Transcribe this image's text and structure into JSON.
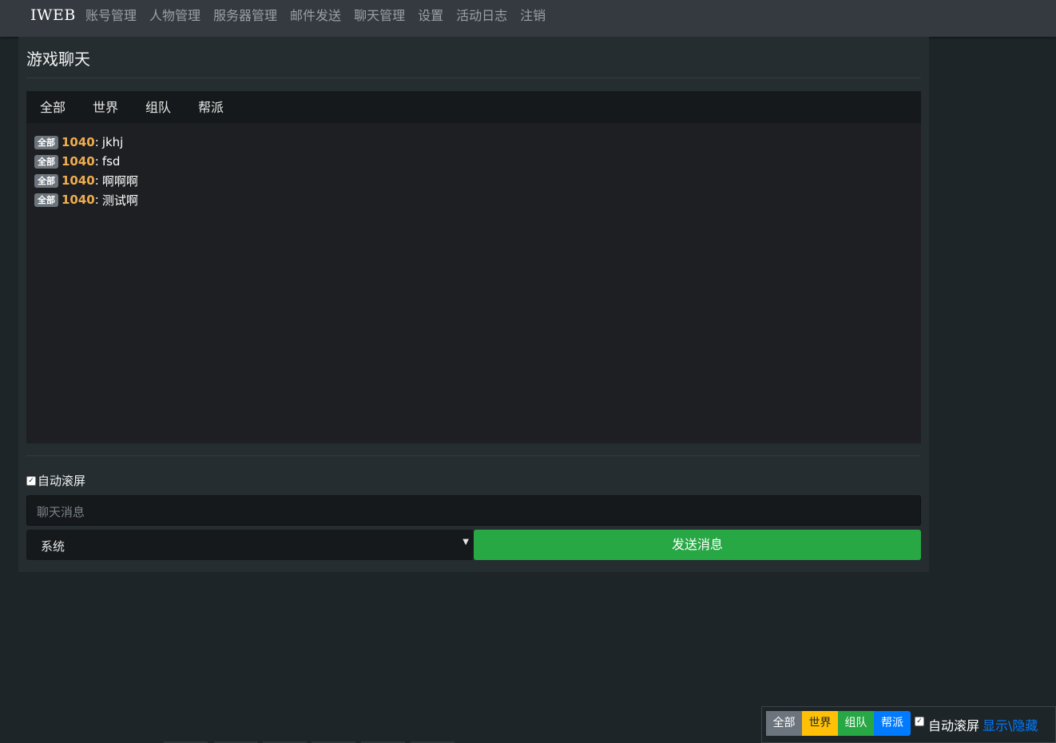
{
  "navbar": {
    "brand": "IWEB",
    "items": [
      "账号管理",
      "人物管理",
      "服务器管理",
      "邮件发送",
      "聊天管理",
      "设置",
      "活动日志",
      "注销"
    ]
  },
  "card": {
    "title": "游戏聊天"
  },
  "tabs": [
    "全部",
    "世界",
    "组队",
    "帮派"
  ],
  "messages": [
    {
      "channel": "全部",
      "user": "1040",
      "text": "jkhj"
    },
    {
      "channel": "全部",
      "user": "1040",
      "text": "fsd"
    },
    {
      "channel": "全部",
      "user": "1040",
      "text": "啊啊啊"
    },
    {
      "channel": "全部",
      "user": "1040",
      "text": "测试啊"
    }
  ],
  "autoscroll": {
    "label": "自动滚屏",
    "checked": true
  },
  "input": {
    "placeholder": "聊天消息"
  },
  "channel_select": {
    "value": "系统"
  },
  "send_button": "发送消息",
  "bottom_panel": {
    "chips": [
      {
        "label": "全部",
        "bg": "#6c757d",
        "fg": "#ffffff"
      },
      {
        "label": "世界",
        "bg": "#ffc107",
        "fg": "#212529"
      },
      {
        "label": "组队",
        "bg": "#28a745",
        "fg": "#ffffff"
      },
      {
        "label": "帮派",
        "bg": "#007bff",
        "fg": "#ffffff"
      }
    ],
    "autoscroll_label": "自动滚屏",
    "toggle_label": "显示\\隐藏"
  },
  "colors": {
    "accent_user": "#f0ad4e",
    "send_button": "#28a745",
    "link": "#007bff"
  }
}
